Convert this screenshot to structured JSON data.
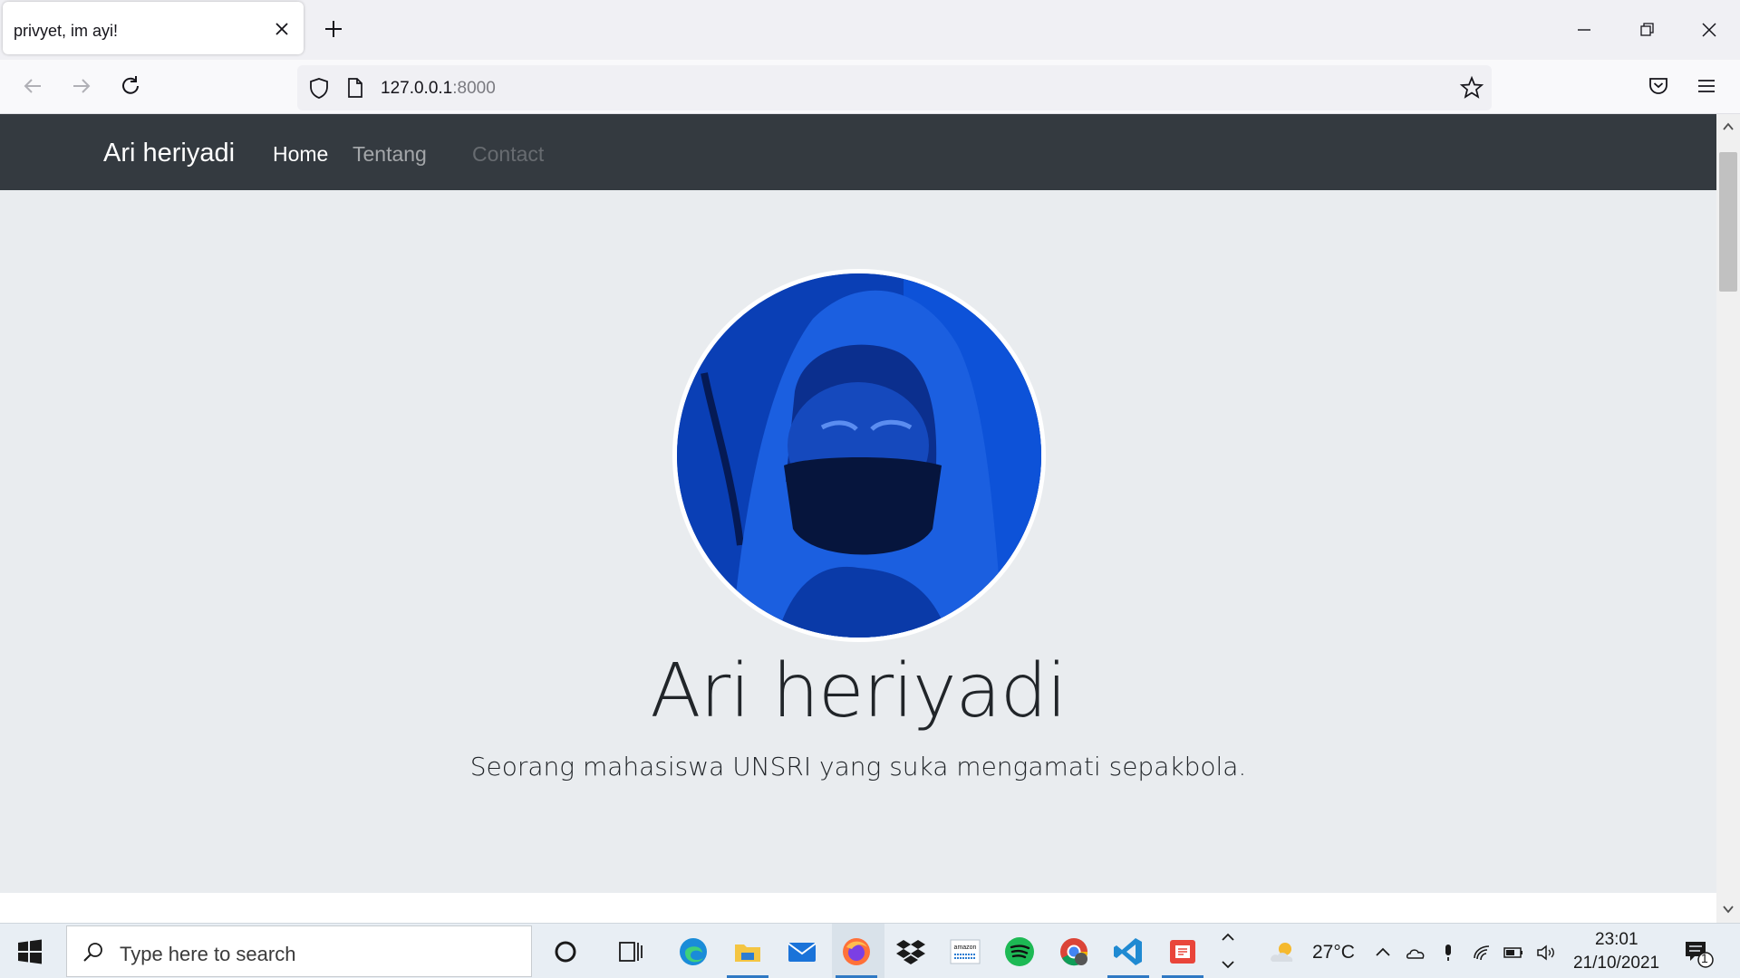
{
  "browser": {
    "tab_title": "privyet, im ayi!",
    "url_host": "127.0.0.1",
    "url_port": ":8000"
  },
  "site": {
    "brand": "Ari heriyadi",
    "nav": [
      "Home",
      "Tentang",
      "Contact"
    ],
    "hero_name": "Ari heriyadi",
    "hero_subtitle": "Seorang mahasiswa UNSRI yang suka mengamati sepakbola."
  },
  "taskbar": {
    "search_placeholder": "Type here to search",
    "weather": "27°C",
    "time": "23:01",
    "date": "21/10/2021",
    "notification_count": "1",
    "apps": [
      "cortana-icon",
      "task-view-icon",
      "edge-icon",
      "file-explorer-icon",
      "mail-icon",
      "firefox-icon",
      "dropbox-icon",
      "amazon-icon",
      "spotify-icon",
      "chrome-icon",
      "vscode-icon",
      "acrobat-icon"
    ]
  },
  "colors": {
    "site_nav_bg": "#343a40",
    "hero_bg": "#e9ecef",
    "avatar_tint": "#0a3fb5",
    "active_underline": "#2f79c4"
  }
}
